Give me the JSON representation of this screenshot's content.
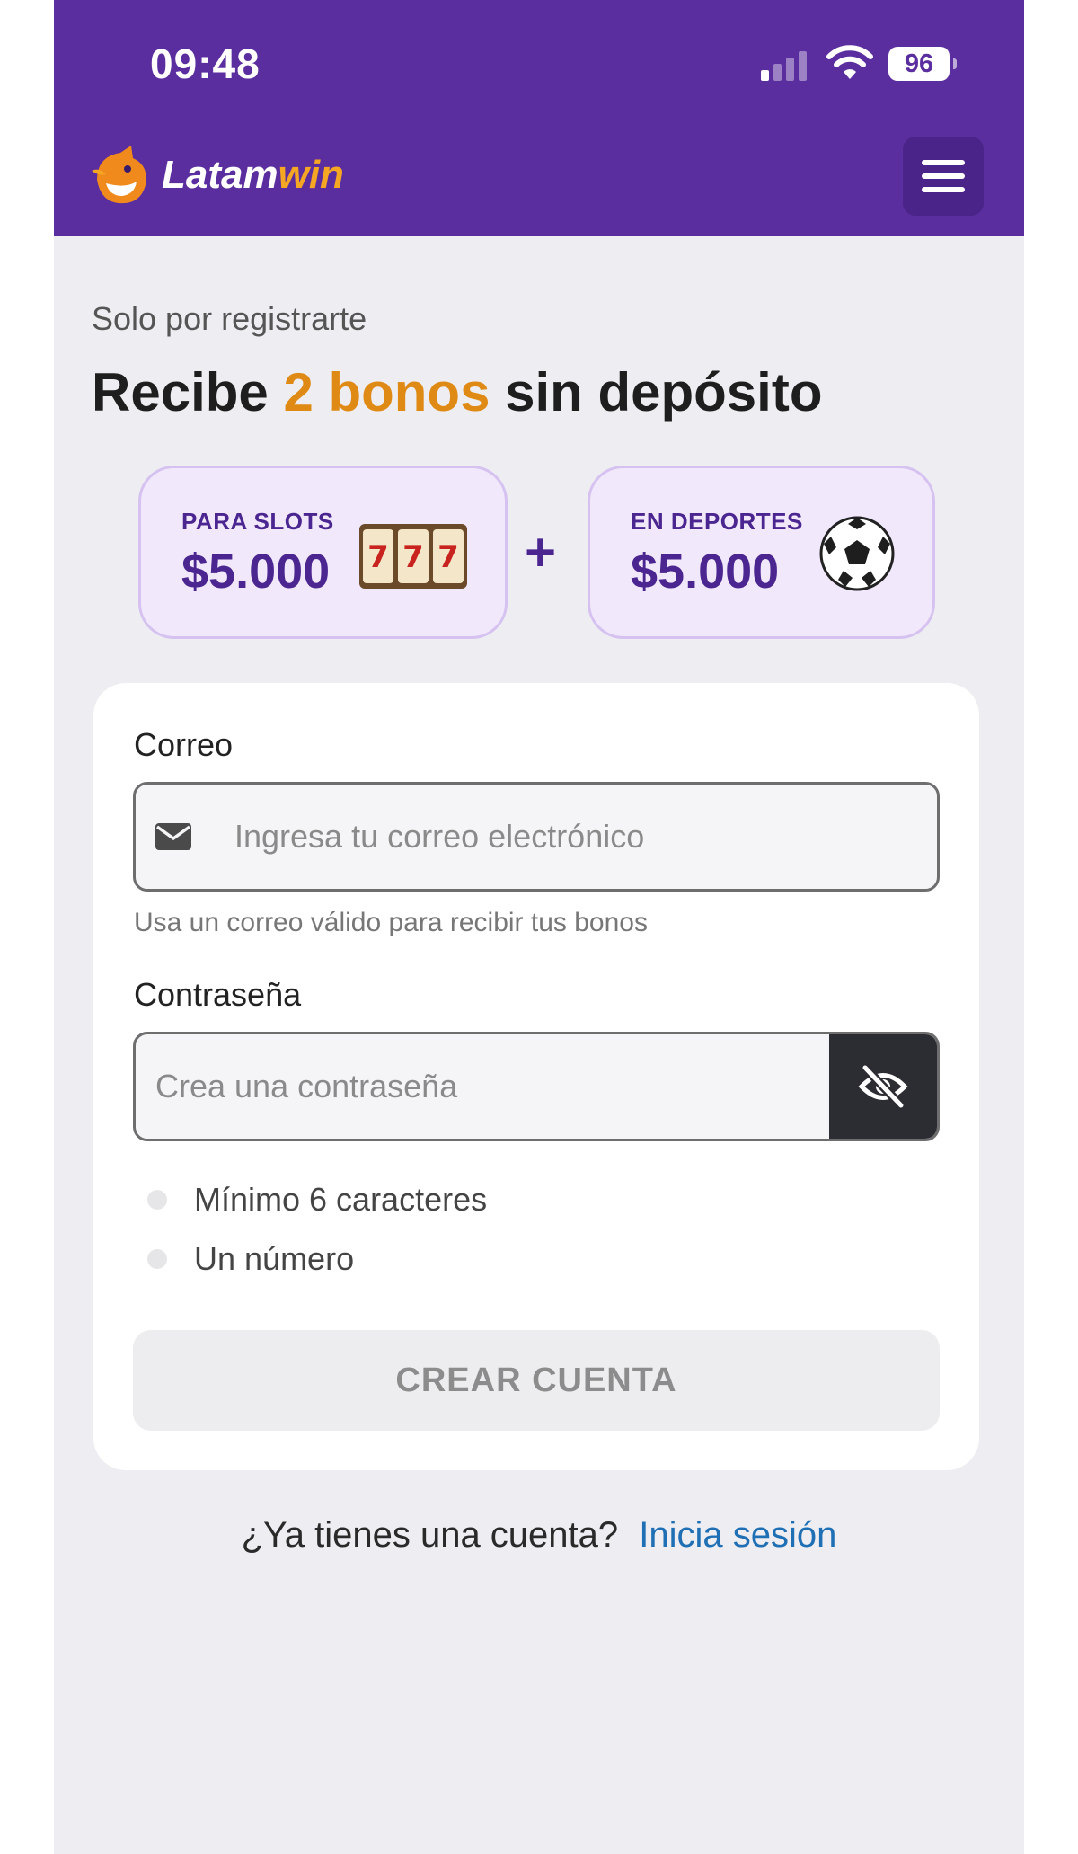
{
  "status_bar": {
    "time": "09:48",
    "battery": "96"
  },
  "header": {
    "brand_main": "Latam",
    "brand_accent": "win",
    "menu_icon": "hamburger-icon",
    "color": "#5b2e9f"
  },
  "hero": {
    "eyebrow": "Solo por registrarte",
    "headline_pre": "Recibe ",
    "headline_highlight": "2 bonos",
    "headline_post": " sin depósito",
    "highlight_color": "#e08a16"
  },
  "bonuses": [
    {
      "label": "PARA SLOTS",
      "amount": "$5.000",
      "icon": "slot-machine-icon"
    },
    {
      "label": "EN DEPORTES",
      "amount": "$5.000",
      "icon": "soccer-ball-icon"
    }
  ],
  "plus_sign": "+",
  "form": {
    "email_label": "Correo",
    "email_placeholder": "Ingresa tu correo electrónico",
    "email_hint": "Usa un correo válido para recibir tus bonos",
    "password_label": "Contraseña",
    "password_placeholder": "Crea una contraseña",
    "rules": [
      "Mínimo 6 caracteres",
      "Un número"
    ],
    "submit_label": "CREAR CUENTA"
  },
  "login": {
    "question": "¿Ya tienes una cuenta?",
    "link": "Inicia sesión",
    "link_color": "#1f6fb5"
  }
}
